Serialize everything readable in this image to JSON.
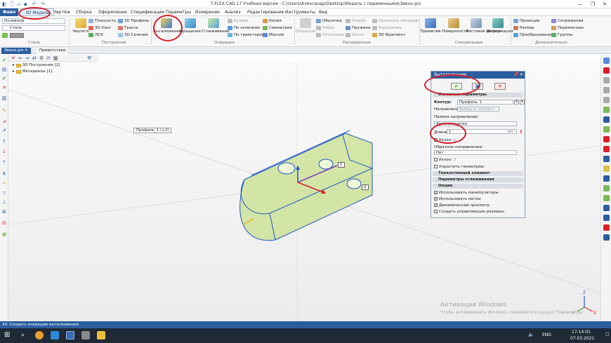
{
  "window": {
    "title": "T-FLEX CAD 17 Учебная версия - C:\\Users\\Александр\\Desktop\\Модель с переменными\\Звено.grs",
    "minimize_glyph": "—",
    "maximize_glyph": "❐",
    "close_glyph": "✕"
  },
  "menu": {
    "file": "Файл",
    "items": [
      "3D Модель",
      "Чертёж",
      "Сборка",
      "Оформление",
      "Спецификации",
      "Параметры",
      "Измерение",
      "Анализ",
      "Редактирование",
      "Инструменты",
      "Вид"
    ]
  },
  "ribbon": {
    "style_group": {
      "label": "Стиль",
      "combo1": "Основной",
      "combo2": "Сталь"
    },
    "construct_group": {
      "label": "Построения",
      "draw": "Чертить",
      "plane": "Плоскость",
      "node": "3D Узел",
      "lsk": "ЛСК",
      "profile": "3D Профиль",
      "path": "Трасса",
      "section": "3D Сечение"
    },
    "ops_group": {
      "label": "Операции",
      "extrude": "Выталкивание",
      "rotate": "Вращение",
      "smooth": "Сглаживание",
      "boolean": "Булева",
      "by_sections": "По сечениям",
      "by_path": "По траектории",
      "copy": "Копия",
      "symmetry": "Симметрия",
      "array": "Массив"
    },
    "ext_group": {
      "label": "Расширенные",
      "shell": "Оболочка",
      "rib": "Ребро",
      "offset": "Отсечение",
      "cut": "Резьба",
      "spring": "Пружина",
      "slope": "Уклон",
      "material": "Наложить материал",
      "simplify": "Упрощение",
      "fragment": "3D Фрагмент",
      "dash": "Открытие"
    },
    "special_group": {
      "label": "Специальные",
      "primitive": "Примитив",
      "surfaces": "Поверхности",
      "sheet": "Листовой металл",
      "deform": "Деформация"
    },
    "extra_group": {
      "label": "Дополнительно",
      "projection": "Проекция",
      "size": "Размер",
      "transform": "Преобразование",
      "mates": "Сопряжения",
      "variables": "Переменные",
      "groups": "Группы"
    }
  },
  "tabs": [
    "Звено.grs",
    "Приветствие"
  ],
  "tree": {
    "items": [
      "3D Построения [2]",
      "Материалы [1]"
    ]
  },
  "viewport": {
    "profile_label": "Профиль_1 (+2)",
    "dim1": "1",
    "dim2": "2",
    "model_color": "#c8e08c",
    "edge_color": "#1f56c7"
  },
  "dialog": {
    "title": "Выталкивание",
    "pin": "📌",
    "close": "✕",
    "ok": "✔",
    "preview": "▣",
    "cancel": "✕",
    "section_main": "Основные параметры",
    "contour_label": "Контур:",
    "contour_value": "Профиль_1",
    "direction_label": "Направление:",
    "direction_value": "Выбрать элемент",
    "forward_label": "Прямое направление:",
    "mode_value": "Автоматически",
    "length_label": "Длина:",
    "length_value": "1",
    "length_unit": "мм",
    "slope1_label": "Уклон:",
    "slope1_value": "1",
    "reverse_label": "Обратное направление:",
    "reverse_value": "Нет",
    "slope2_label": "Уклон:",
    "slope2_value": "3",
    "simplify": "Упростить геометрию",
    "thin": "Тонкостенный элемент",
    "smoothing": "Параметры сглаживания",
    "options": "Опции",
    "opt1": "Использовать манипуляторы",
    "opt2": "Использовать метки",
    "opt3": "Динамический просмотр",
    "opt4": "Создать управляющие размеры"
  },
  "watermark": {
    "line1": "Активация Windows",
    "line2": "Чтобы активировать Windows, перейдите в раздел \"Параметры\"."
  },
  "status": "3Х: Создать операцию выталкивания",
  "taskbar": {
    "lang": "ENG",
    "time": "17:14:01",
    "date": "07.03.2021"
  },
  "colors": {
    "accent": "#2b5d9f",
    "highlight": "#d61f2a"
  }
}
